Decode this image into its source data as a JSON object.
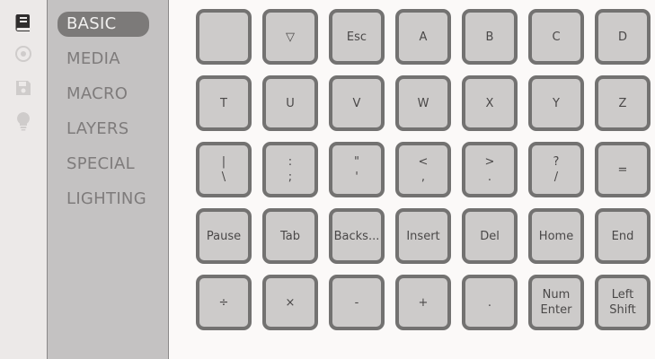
{
  "sidebar_icons": [
    {
      "name": "book-icon",
      "active": true
    },
    {
      "name": "target-icon",
      "active": false
    },
    {
      "name": "save-icon",
      "active": false
    },
    {
      "name": "lightbulb-icon",
      "active": false
    }
  ],
  "menu": {
    "items": [
      {
        "label": "BASIC",
        "active": true
      },
      {
        "label": "MEDIA",
        "active": false
      },
      {
        "label": "MACRO",
        "active": false
      },
      {
        "label": "LAYERS",
        "active": false
      },
      {
        "label": "SPECIAL",
        "active": false
      },
      {
        "label": "LIGHTING",
        "active": false
      }
    ]
  },
  "keys": [
    [
      [
        ""
      ],
      [
        "▽"
      ],
      [
        "Esc"
      ],
      [
        "A"
      ],
      [
        "B"
      ],
      [
        "C"
      ],
      [
        "D"
      ]
    ],
    [
      [
        "T"
      ],
      [
        "U"
      ],
      [
        "V"
      ],
      [
        "W"
      ],
      [
        "X"
      ],
      [
        "Y"
      ],
      [
        "Z"
      ]
    ],
    [
      [
        "|",
        "\\"
      ],
      [
        ":",
        ";"
      ],
      [
        "\"",
        "'"
      ],
      [
        "<",
        ","
      ],
      [
        ">",
        "."
      ],
      [
        "?",
        "/"
      ],
      [
        "="
      ]
    ],
    [
      [
        "Pause"
      ],
      [
        "Tab"
      ],
      [
        "Backs..."
      ],
      [
        "Insert"
      ],
      [
        "Del"
      ],
      [
        "Home"
      ],
      [
        "End"
      ]
    ],
    [
      [
        "÷"
      ],
      [
        "×"
      ],
      [
        "-"
      ],
      [
        "+"
      ],
      [
        "."
      ],
      [
        "Num",
        "Enter"
      ],
      [
        "Left",
        "Shift"
      ]
    ]
  ],
  "colors": {
    "active_icon": "#2f2d2d",
    "inactive_icon": "#cfcccb",
    "key_fill": "#cdcbca",
    "key_border": "#737271"
  }
}
